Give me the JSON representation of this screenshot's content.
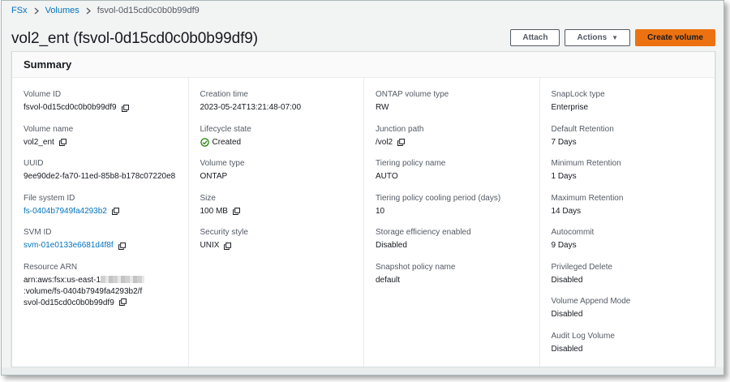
{
  "breadcrumb": {
    "items": [
      {
        "label": "FSx"
      },
      {
        "label": "Volumes"
      }
    ],
    "current": "fsvol-0d15cd0c0b0b99df9"
  },
  "page": {
    "title": "vol2_ent (fsvol-0d15cd0c0b0b99df9)"
  },
  "actions": {
    "attach": "Attach",
    "actions": "Actions",
    "create_volume": "Create volume"
  },
  "summary": {
    "title": "Summary",
    "col1": {
      "volume_id_label": "Volume ID",
      "volume_id": "fsvol-0d15cd0c0b0b99df9",
      "volume_name_label": "Volume name",
      "volume_name": "vol2_ent",
      "uuid_label": "UUID",
      "uuid": "9ee90de2-fa70-11ed-85b8-b178c07220e8",
      "file_system_id_label": "File system ID",
      "file_system_id": "fs-0404b7949fa4293b2",
      "svm_id_label": "SVM ID",
      "svm_id": "svm-01e0133e6681d4f8f",
      "resource_arn_label": "Resource ARN",
      "resource_arn_part1": "arn:aws:fsx:us-east-1",
      "resource_arn_part2": ":volume/fs-0404b7949fa4293b2/fsvol-0d15cd0c0b0b99df9"
    },
    "col2": {
      "creation_time_label": "Creation time",
      "creation_time": "2023-05-24T13:21:48-07:00",
      "lifecycle_label": "Lifecycle state",
      "lifecycle": "Created",
      "volume_type_label": "Volume type",
      "volume_type": "ONTAP",
      "size_label": "Size",
      "size": "100 MB",
      "security_style_label": "Security style",
      "security_style": "UNIX"
    },
    "col3": {
      "ontap_type_label": "ONTAP volume type",
      "ontap_type": "RW",
      "junction_label": "Junction path",
      "junction": "/vol2",
      "tiering_name_label": "Tiering policy name",
      "tiering_name": "AUTO",
      "tiering_cooling_label": "Tiering policy cooling period (days)",
      "tiering_cooling": "10",
      "storage_eff_label": "Storage efficiency enabled",
      "storage_eff": "Disabled",
      "snapshot_label": "Snapshot policy name",
      "snapshot": "default"
    },
    "col4": {
      "snaplock_type_label": "SnapLock type",
      "snaplock_type": "Enterprise",
      "default_ret_label": "Default Retention",
      "default_ret": "7 Days",
      "min_ret_label": "Minimum Retention",
      "min_ret": "1 Days",
      "max_ret_label": "Maximum Retention",
      "max_ret": "14 Days",
      "autocommit_label": "Autocommit",
      "autocommit": "9 Days",
      "priv_delete_label": "Privileged Delete",
      "priv_delete": "Disabled",
      "append_mode_label": "Volume Append Mode",
      "append_mode": "Disabled",
      "audit_log_label": "Audit Log Volume",
      "audit_log": "Disabled"
    }
  },
  "colors": {
    "link": "#0073bb",
    "primary": "#ec7211",
    "success": "#1d8102",
    "text": "#16191f",
    "label": "#545b64"
  },
  "icons": {
    "copy": "copy-icon",
    "status": "status-positive-icon",
    "separator": "chevron-right-icon",
    "dropdown": "caret-down-icon"
  }
}
